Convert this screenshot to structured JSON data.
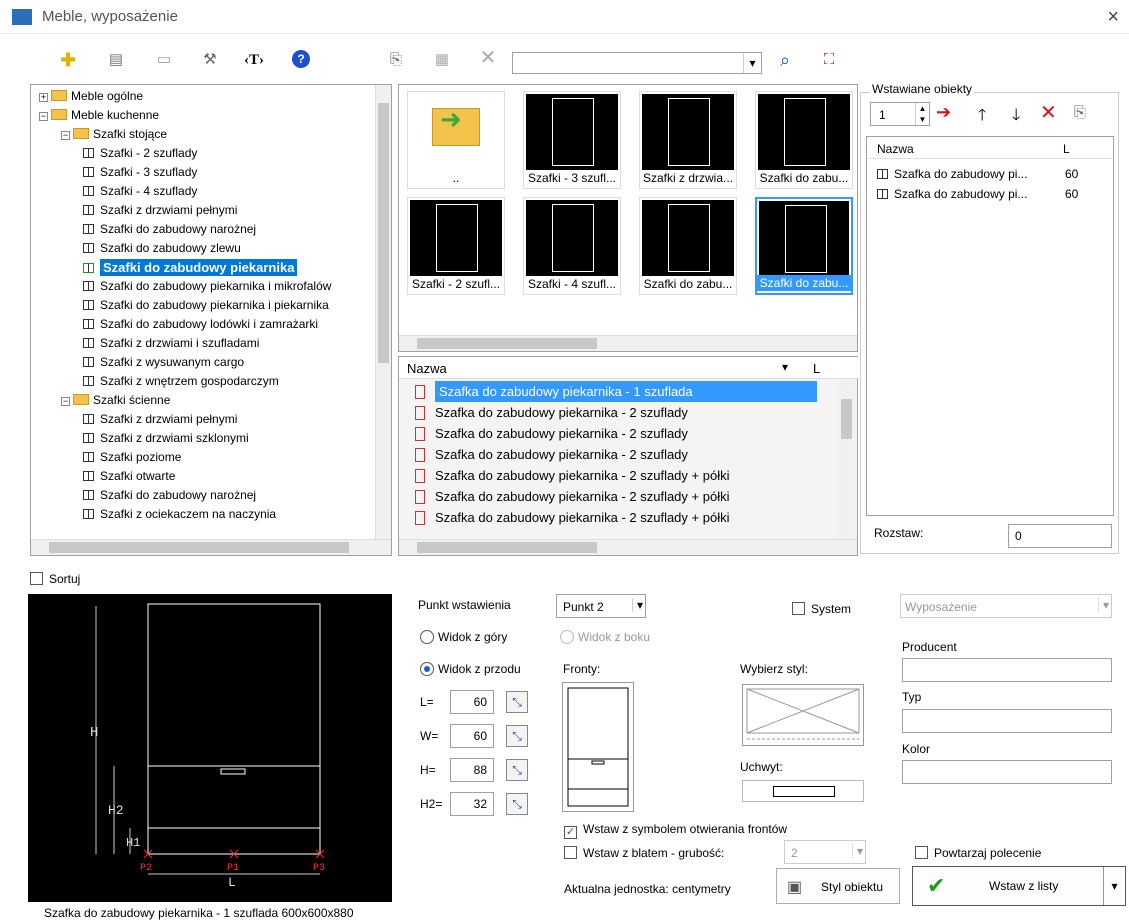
{
  "window": {
    "title": "Meble, wyposażenie",
    "close": "×"
  },
  "toolbar": {
    "search_value": "",
    "dropdown_arrow": "▾",
    "help": "?",
    "text_tool": "‹T›",
    "delete": "✕"
  },
  "tree": {
    "items": [
      {
        "label": "Meble ogólne",
        "type": "folder",
        "expander": "+"
      },
      {
        "label": "Meble kuchenne",
        "type": "folder",
        "expander": "−"
      },
      {
        "label": "Szafki stojące",
        "type": "folder",
        "expander": "−"
      },
      {
        "label": "Szafki - 2 szuflady",
        "type": "item"
      },
      {
        "label": "Szafki - 3 szuflady",
        "type": "item"
      },
      {
        "label": "Szafki - 4 szuflady",
        "type": "item"
      },
      {
        "label": "Szafki z drzwiami pełnymi",
        "type": "item"
      },
      {
        "label": "Szafki do zabudowy narożnej",
        "type": "item"
      },
      {
        "label": "Szafki do zabudowy zlewu",
        "type": "item"
      },
      {
        "label": "Szafki do zabudowy piekarnika",
        "type": "item",
        "selected": true
      },
      {
        "label": "Szafki do zabudowy piekarnika i mikrofalów",
        "type": "item"
      },
      {
        "label": "Szafki do zabudowy piekarnika i piekarnika",
        "type": "item"
      },
      {
        "label": "Szafki do zabudowy lodówki i zamrażarki",
        "type": "item"
      },
      {
        "label": "Szafki z drzwiami i szufladami",
        "type": "item"
      },
      {
        "label": "Szafki z wysuwanym cargo",
        "type": "item"
      },
      {
        "label": "Szafki z wnętrzem gospodarczym",
        "type": "item"
      },
      {
        "label": "Szafki ścienne",
        "type": "folder",
        "expander": "−"
      },
      {
        "label": "Szafki z drzwiami pełnymi",
        "type": "item"
      },
      {
        "label": "Szafki z drzwiami szklonymi",
        "type": "item"
      },
      {
        "label": "Szafki poziome",
        "type": "item"
      },
      {
        "label": "Szafki otwarte",
        "type": "item"
      },
      {
        "label": "Szafki do zabudowy narożnej",
        "type": "item"
      },
      {
        "label": "Szafki z ociekaczem na naczynia",
        "type": "item"
      }
    ]
  },
  "thumbnails": [
    {
      "label": ".."
    },
    {
      "label": "Szafki - 3 szufl..."
    },
    {
      "label": "Szafki z drzwia..."
    },
    {
      "label": "Szafki do zabu..."
    },
    {
      "label": "Szafki - 2 szufl..."
    },
    {
      "label": "Szafki - 4 szufl..."
    },
    {
      "label": "Szafki do zabu..."
    },
    {
      "label": "Szafki do zabu...",
      "selected": true
    }
  ],
  "list": {
    "header_name": "Nazwa",
    "header_l": "L",
    "rows": [
      {
        "label": "Szafka do zabudowy piekarnika - 1 szuflada",
        "selected": true
      },
      {
        "label": "Szafka do zabudowy piekarnika - 2 szuflady"
      },
      {
        "label": "Szafka do zabudowy piekarnika - 2 szuflady"
      },
      {
        "label": "Szafka do zabudowy piekarnika - 2 szuflady"
      },
      {
        "label": "Szafka do zabudowy piekarnika - 2 szuflady + półki"
      },
      {
        "label": "Szafka do zabudowy piekarnika - 2 szuflady + półki"
      },
      {
        "label": "Szafka do zabudowy piekarnika - 2 szuflady + półki"
      }
    ]
  },
  "inserted": {
    "group_label": "Wstawiane obiekty",
    "count": "1",
    "header_name": "Nazwa",
    "header_l": "L",
    "rows": [
      {
        "label": "Szafka do zabudowy pi...",
        "l": "60"
      },
      {
        "label": "Szafka do zabudowy pi...",
        "l": "60"
      }
    ],
    "spacing_label": "Rozstaw:",
    "spacing_value": "0"
  },
  "sort_label": "Sortuj",
  "preview": {
    "caption": "Szafka do zabudowy piekarnika - 1 szuflada 600x600x880",
    "labels": {
      "h": "H",
      "h2": "H2",
      "h1": "H1",
      "l": "L",
      "p1": "P1",
      "p2": "P2",
      "p3": "P3"
    }
  },
  "insert_point": {
    "label": "Punkt wstawienia",
    "value": "Punkt 2",
    "view_top": "Widok z góry",
    "view_side": "Widok z boku",
    "view_front": "Widok z przodu"
  },
  "dims": [
    {
      "label": "L=",
      "value": "60"
    },
    {
      "label": "W=",
      "value": "60"
    },
    {
      "label": "H=",
      "value": "88"
    },
    {
      "label": "H2=",
      "value": "32"
    }
  ],
  "fronts_label": "Fronty:",
  "style_label": "Wybierz styl:",
  "handle_label": "Uchwyt:",
  "system": {
    "label": "System",
    "category_value": "Wyposażenie",
    "producer_label": "Producent",
    "type_label": "Typ",
    "color_label": "Kolor"
  },
  "options": {
    "insert_symbol": "Wstaw z symbolem otwierania frontów",
    "insert_top": "Wstaw z blatem - grubość:",
    "top_thickness": "2",
    "repeat": "Powtarzaj polecenie",
    "unit": "Aktualna jednostka: centymetry"
  },
  "buttons": {
    "object_style": "Styl obiektu",
    "insert_from_list": "Wstaw z listy"
  },
  "colors": {
    "accent": "#0078d7",
    "selected_bg": "#3399ff",
    "red": "#cc2222"
  }
}
